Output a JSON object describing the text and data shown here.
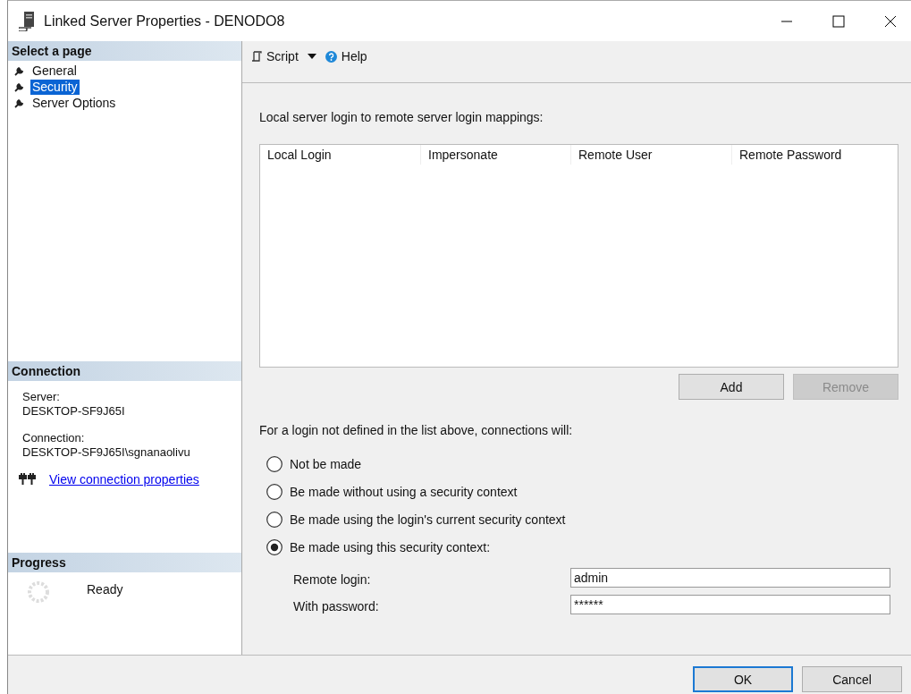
{
  "window": {
    "title": "Linked Server Properties - DENODO8"
  },
  "sidebar": {
    "heading": "Select a page",
    "items": [
      {
        "label": "General",
        "selected": false
      },
      {
        "label": "Security",
        "selected": true
      },
      {
        "label": "Server Options",
        "selected": false
      }
    ]
  },
  "connection": {
    "heading": "Connection",
    "server_label": "Server:",
    "server": "DESKTOP-SF9J65I",
    "connection_label": "Connection:",
    "connection": "DESKTOP-SF9J65I\\sgnanaolivu",
    "link": "View connection properties"
  },
  "progress": {
    "heading": "Progress",
    "status": "Ready"
  },
  "toolbar": {
    "script": "Script",
    "help": "Help"
  },
  "mappings": {
    "label": "Local server login to remote server login mappings:",
    "columns": [
      "Local Login",
      "Impersonate",
      "Remote User",
      "Remote Password"
    ]
  },
  "list_buttons": [
    {
      "label": "Add",
      "disabled": false
    },
    {
      "label": "Remove",
      "disabled": true
    }
  ],
  "fallback": {
    "label": "For a login not defined in the list above, connections will:",
    "options": [
      {
        "label": "Not be made",
        "selected": false
      },
      {
        "label": "Be made without using a security context",
        "selected": false
      },
      {
        "label": "Be made using the login's current security context",
        "selected": false
      },
      {
        "label": "Be made using this security context:",
        "selected": true
      }
    ]
  },
  "fields": [
    {
      "label": "Remote login:",
      "value": "admin"
    },
    {
      "label": "With password:",
      "value": "******"
    }
  ],
  "buttons": [
    {
      "label": "OK",
      "default": true
    },
    {
      "label": "Cancel",
      "default": false
    }
  ]
}
